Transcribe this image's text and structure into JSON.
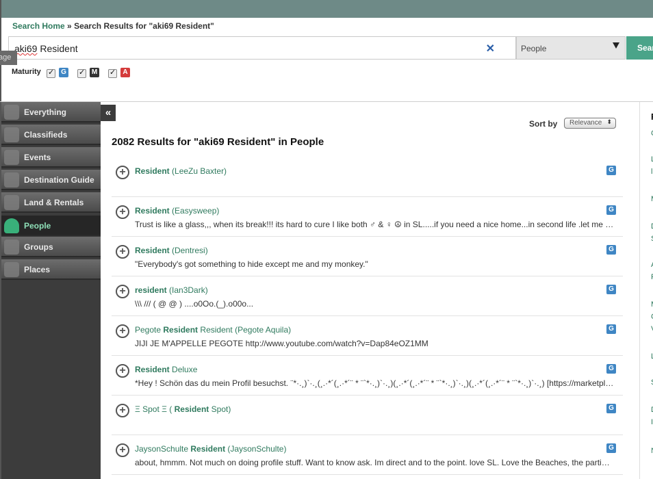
{
  "breadcrumb": {
    "home": "Search Home",
    "sep": "»",
    "current": "Search Results for \"aki69 Resident\""
  },
  "search": {
    "value_prefix": "aki69",
    "value_rest": " Resident",
    "clear_icon": "close-icon",
    "button_label": "Search"
  },
  "scope": {
    "selected": "People"
  },
  "lang_tab": "age",
  "maturity": {
    "label": "Maturity",
    "options": [
      {
        "code": "G",
        "color": "#3f86c4",
        "checked": true
      },
      {
        "code": "M",
        "color": "#333333",
        "checked": true
      },
      {
        "code": "A",
        "color": "#d43b3b",
        "checked": true
      }
    ]
  },
  "sidebar": {
    "collapse_label": "«",
    "items": [
      {
        "label": "Everything",
        "icon": "hand-icon"
      },
      {
        "label": "Classifieds",
        "icon": "tag-icon"
      },
      {
        "label": "Events",
        "icon": "calendar-icon"
      },
      {
        "label": "Destination Guide",
        "icon": "globe-icon"
      },
      {
        "label": "Land & Rentals",
        "icon": "land-icon"
      },
      {
        "label": "People",
        "icon": "person-icon"
      },
      {
        "label": "Groups",
        "icon": "group-icon"
      },
      {
        "label": "Places",
        "icon": "pin-icon"
      }
    ]
  },
  "sort": {
    "label": "Sort by",
    "selected": "Relevance"
  },
  "results": {
    "title": "2082 Results for \"aki69 Resident\" in People",
    "items": [
      {
        "pre": "",
        "bold": "Resident",
        "post": " (LeeZu Baxter)",
        "desc": "",
        "rating": "G"
      },
      {
        "pre": "",
        "bold": "Resident",
        "post": " (Easysweep)",
        "desc": "Trust is like a glass,,, when its break!!! its hard to cure I like both ♂ & ♀ ☮ in SL.....if you need a nice home...in second life .let me know I can",
        "rating": "G"
      },
      {
        "pre": "",
        "bold": "Resident",
        "post": " (Dentresi)",
        "desc": "\"Everybody's got something to hide except me and my monkey.\"",
        "rating": "G"
      },
      {
        "pre": "",
        "bold": "resident",
        "post": " (Ian3Dark)",
        "desc": "\\\\\\ /// ( @ @ ) ....o0Oo.(_).o00o...",
        "rating": "G"
      },
      {
        "pre": "Pegote ",
        "bold": "Resident",
        "post": " Resident (Pegote Aquila)",
        "desc": "JIJI JE M'APPELLE PEGOTE http://www.youtube.com/watch?v=Dap84eOZ1MM",
        "rating": "G"
      },
      {
        "pre": "",
        "bold": "Resident",
        "post": " Deluxe",
        "desc": "*Hey ! Schön das du mein Profil besuchst. ¨*·.¸)`·.¸(¸.·*´(¸.·*´¨ * ¨`*·.¸)`·.¸)(¸.·*´(¸.·*´¨ * ¨`*·.¸)`·.¸)(¸.·*´(¸.·*´¨ * ¨`*·.¸)`·.¸) [https://marketplace.secondlife.com]",
        "rating": "G"
      },
      {
        "pre": "Ξ Spot Ξ ( ",
        "bold": "Resident",
        "post": " Spot)",
        "desc": "",
        "rating": "G"
      },
      {
        "pre": "JaysonSchulte ",
        "bold": "Resident",
        "post": " (JaysonSchulte)",
        "desc": "about, hmmm. Not much on doing profile stuff. Want to know ask. Im direct and to the point. love SL. Love the Beaches, the parties and the people",
        "rating": "G"
      }
    ]
  },
  "right_panel": {
    "heading": "R",
    "letters": [
      "C",
      "L",
      "l",
      "M",
      "D",
      "S",
      "A",
      "F",
      "M",
      "C",
      "V",
      "L",
      "S",
      "D",
      "I",
      "N"
    ]
  }
}
